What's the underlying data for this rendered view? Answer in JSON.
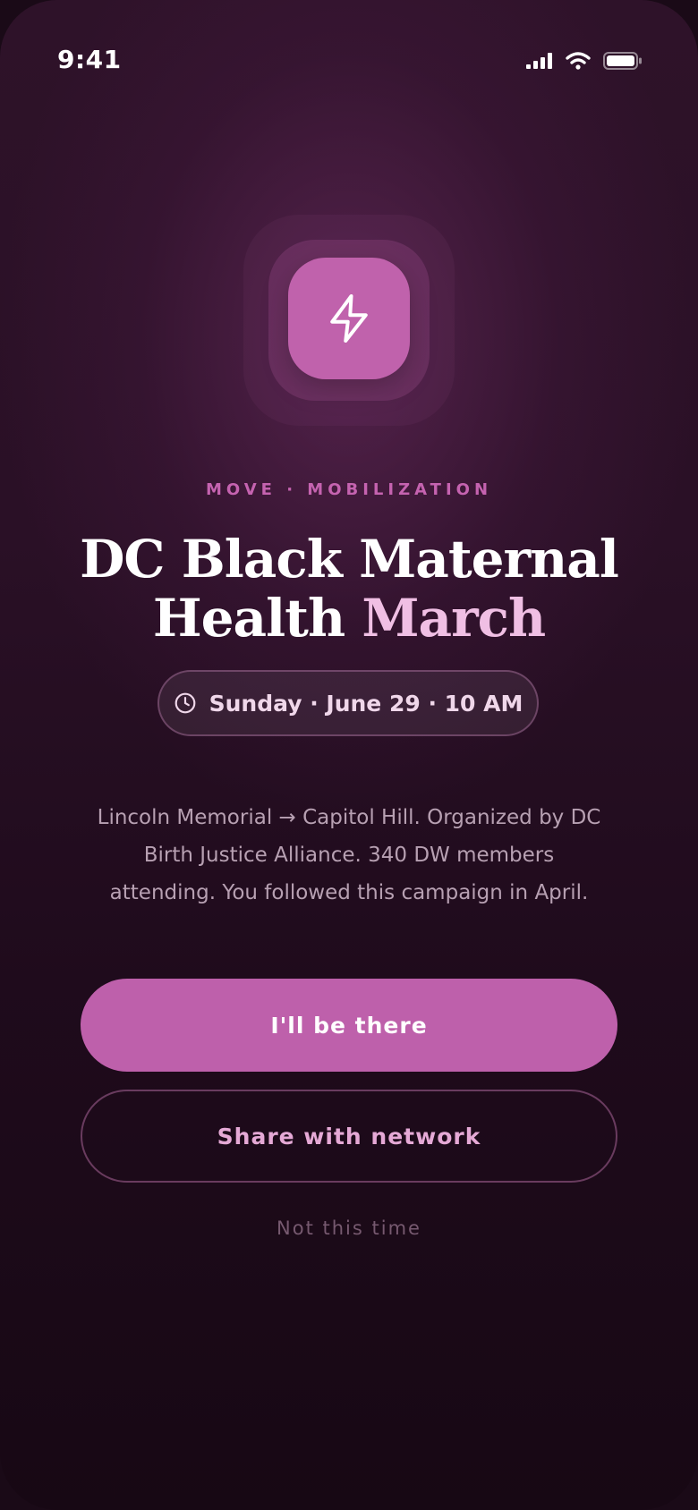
{
  "status_bar": {
    "time": "9:41",
    "icons": [
      "signal-icon",
      "wifi-icon",
      "battery-icon"
    ]
  },
  "hero": {
    "icon": "lightning-bolt-icon",
    "tile_color": "#c062ac"
  },
  "event": {
    "eyebrow": "MOVE · MOBILIZATION",
    "title_line1": "DC Black Maternal",
    "title_line2_plain": "Health ",
    "title_line2_accent": "March",
    "date_icon": "clock-icon",
    "date_text": "Sunday · June 29 · 10 AM",
    "description": "Lincoln Memorial → Capitol Hill. Organized by DC Birth Justice Alliance. 340 DW members attending. You followed this campaign in April."
  },
  "actions": {
    "primary_label": "I'll be there",
    "secondary_label": "Share with network",
    "dismiss_label": "Not this time"
  },
  "colors": {
    "accent": "#be60ab",
    "accent_light": "#f0bfe4",
    "background": "#2a1026",
    "muted_text": "#b7a0b2"
  }
}
